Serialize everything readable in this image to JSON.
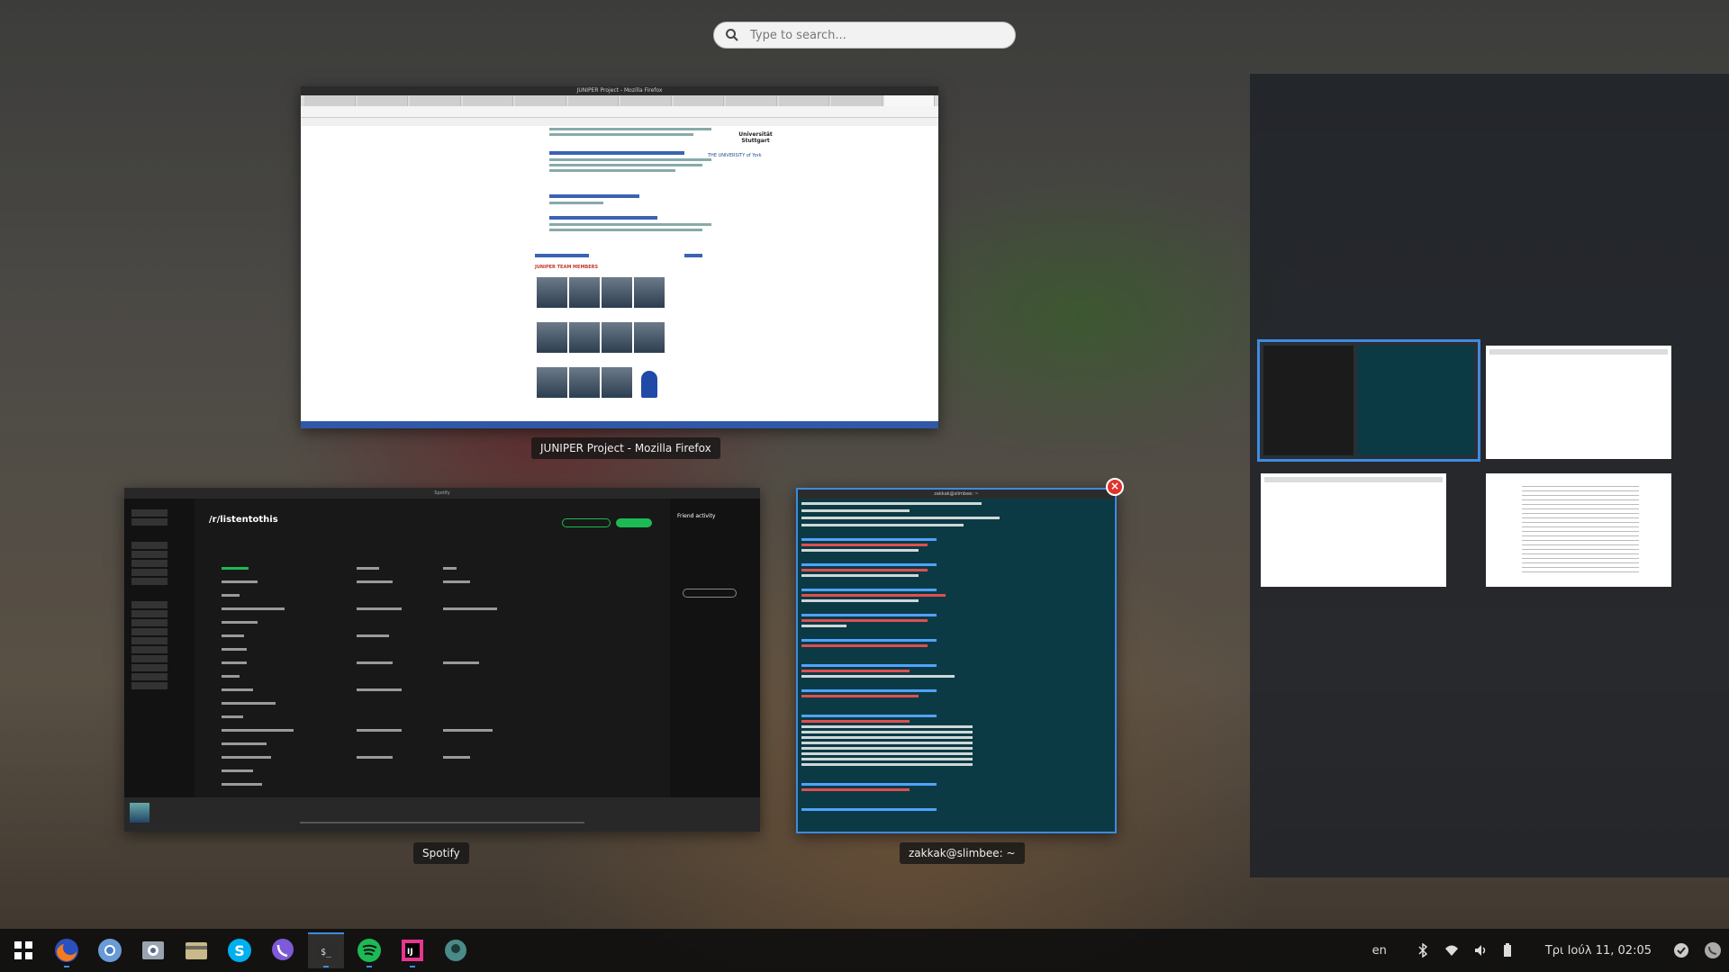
{
  "search": {
    "placeholder": "Type to search..."
  },
  "windows": {
    "firefox": {
      "title": "JUNIPER Project - Mozilla Firefox",
      "caption": "JUNIPER Project - Mozilla Firefox",
      "team_heading": "JUNIPER TEAM MEMBERS",
      "uni_name": "Universität Stuttgart",
      "york_name": "THE UNIVERSITY of York"
    },
    "spotify": {
      "title": "Spotify",
      "caption": "Spotify",
      "header": "/r/listentothis",
      "friend_activity": "Friend activity"
    },
    "terminal": {
      "title": "zakkak@slimbee: ~",
      "caption": "zakkak@slimbee: ~"
    }
  },
  "taskbar": {
    "apps": [
      "app-menu",
      "firefox",
      "chromium",
      "mail",
      "files",
      "skype",
      "viber",
      "terminal",
      "spotify",
      "intellij",
      "other"
    ],
    "language": "en",
    "clock": "Τρι Ιούλ 11, 02:05"
  },
  "colors": {
    "accent": "#3d8be0",
    "close": "#e0322c",
    "spotify_green": "#1db954"
  }
}
